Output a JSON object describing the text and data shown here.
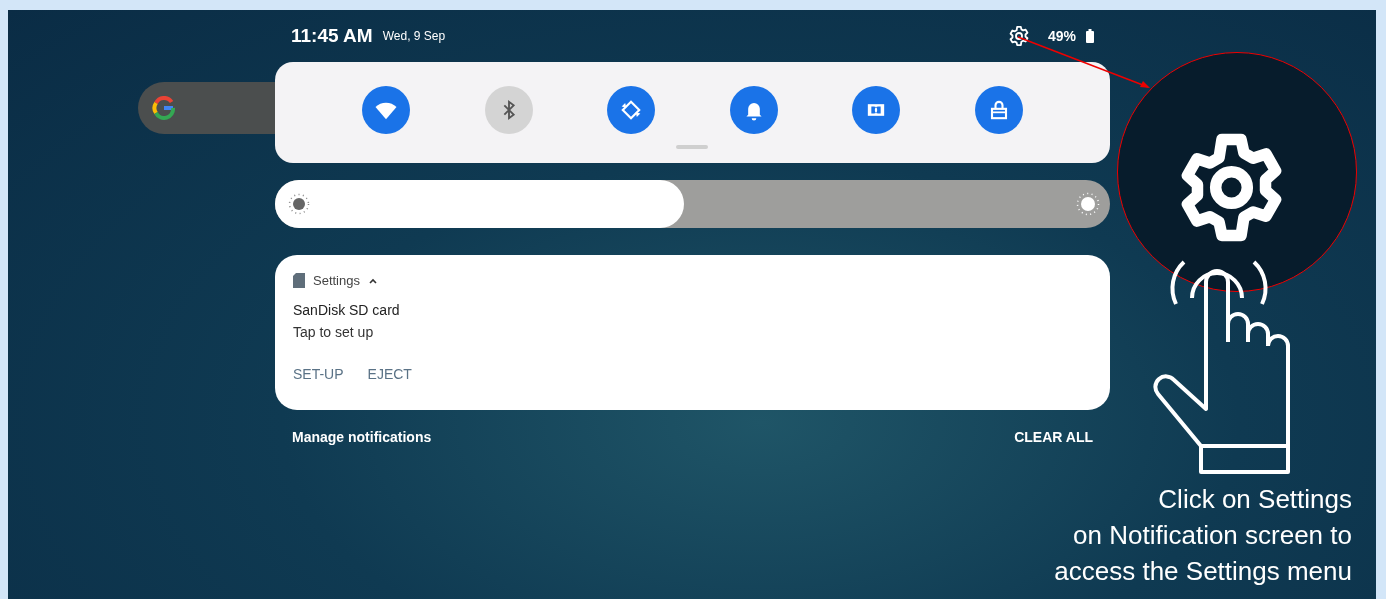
{
  "status_bar": {
    "time": "11:45 AM",
    "date": "Wed, 9 Sep",
    "battery": "49%"
  },
  "quick_settings": [
    {
      "kind": "wifi",
      "on": true
    },
    {
      "kind": "bluetooth",
      "on": false
    },
    {
      "kind": "rotate",
      "on": true
    },
    {
      "kind": "bell",
      "on": true
    },
    {
      "kind": "dolby",
      "on": true
    },
    {
      "kind": "lock",
      "on": true
    }
  ],
  "brightness": {
    "level": 0.49
  },
  "notification": {
    "app": "Settings",
    "expanded": true,
    "title": "SanDisk SD card",
    "text": "Tap to set up",
    "actions": [
      "SET-UP",
      "EJECT"
    ]
  },
  "footer": {
    "manage": "Manage notifications",
    "clear": "CLEAR ALL"
  },
  "callout": {
    "caption": [
      "Click on Settings",
      "on Notification screen to",
      "access the Settings menu"
    ]
  }
}
